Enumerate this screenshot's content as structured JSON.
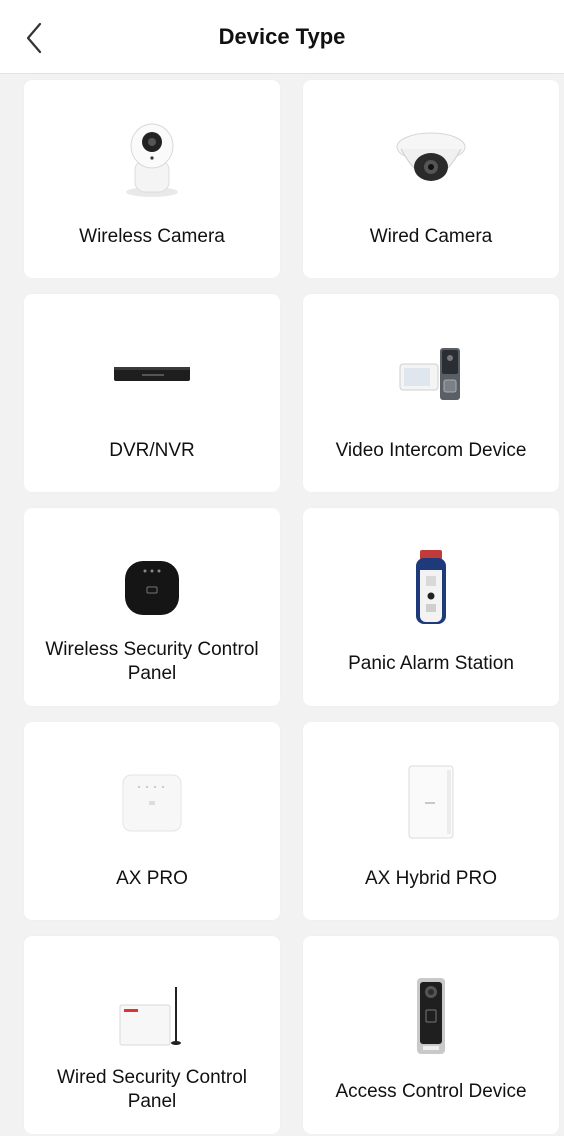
{
  "header": {
    "title": "Device Type"
  },
  "devices": [
    {
      "label": "Wireless Camera",
      "icon": "wireless-camera-icon"
    },
    {
      "label": "Wired Camera",
      "icon": "dome-camera-icon"
    },
    {
      "label": "DVR/NVR",
      "icon": "dvr-nvr-icon"
    },
    {
      "label": "Video Intercom Device",
      "icon": "video-intercom-icon"
    },
    {
      "label": "Wireless Security Control Panel",
      "icon": "wireless-panel-icon"
    },
    {
      "label": "Panic Alarm Station",
      "icon": "panic-alarm-icon"
    },
    {
      "label": "AX PRO",
      "icon": "ax-pro-icon"
    },
    {
      "label": "AX Hybrid PRO",
      "icon": "ax-hybrid-pro-icon"
    },
    {
      "label": "Wired Security Control Panel",
      "icon": "wired-panel-icon"
    },
    {
      "label": "Access Control Device",
      "icon": "access-control-icon"
    }
  ]
}
